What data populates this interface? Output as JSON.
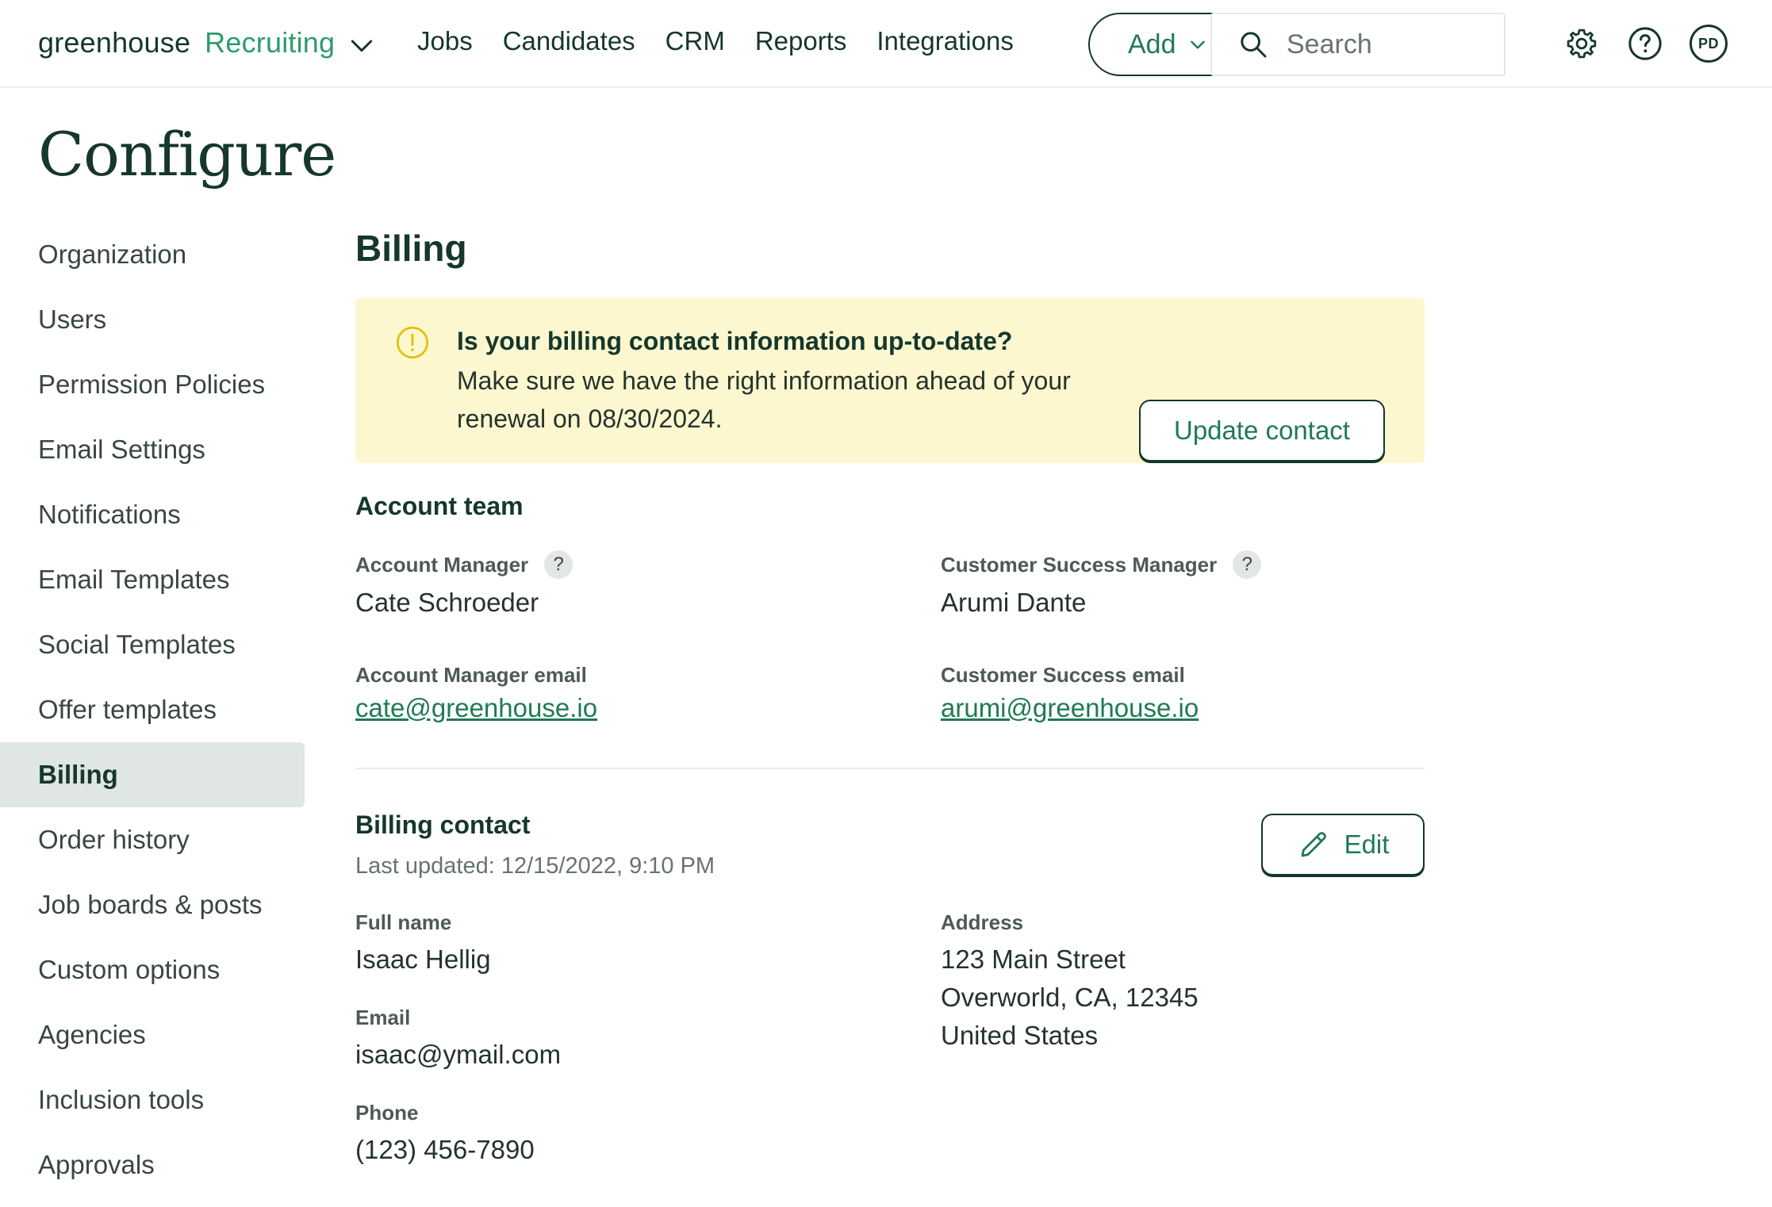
{
  "brand": {
    "name": "greenhouse",
    "product": "Recruiting"
  },
  "nav": {
    "items": [
      "Jobs",
      "Candidates",
      "CRM",
      "Reports",
      "Integrations"
    ]
  },
  "toolbar": {
    "add_label": "Add",
    "search_placeholder": "Search",
    "avatar_initials": "PD"
  },
  "page": {
    "title": "Configure"
  },
  "sidebar": {
    "items": [
      {
        "label": "Organization"
      },
      {
        "label": "Users"
      },
      {
        "label": "Permission Policies"
      },
      {
        "label": "Email Settings"
      },
      {
        "label": "Notifications"
      },
      {
        "label": "Email Templates"
      },
      {
        "label": "Social Templates"
      },
      {
        "label": "Offer templates"
      },
      {
        "label": "Billing",
        "active": true
      },
      {
        "label": "Order history"
      },
      {
        "label": "Job boards & posts"
      },
      {
        "label": "Custom options"
      },
      {
        "label": "Agencies"
      },
      {
        "label": "Inclusion tools"
      },
      {
        "label": "Approvals"
      }
    ]
  },
  "billing": {
    "title": "Billing",
    "alert": {
      "title": "Is your billing contact information up-to-date?",
      "body": "Make sure we have the right information ahead of your renewal on 08/30/2024.",
      "button": "Update contact",
      "icon": "warning-icon"
    },
    "account_team": {
      "title": "Account team",
      "account_manager_label": "Account Manager",
      "account_manager": "Cate Schroeder",
      "csm_label": "Customer Success Manager",
      "csm": "Arumi Dante",
      "am_email_label": "Account Manager email",
      "am_email": "cate@greenhouse.io",
      "cs_email_label": "Customer Success email",
      "cs_email": "arumi@greenhouse.io"
    },
    "contact": {
      "title": "Billing contact",
      "last_updated": "Last updated: 12/15/2022, 9:10 PM",
      "edit_label": "Edit",
      "full_name_label": "Full name",
      "full_name": "Isaac Hellig",
      "email_label": "Email",
      "email": "isaac@ymail.com",
      "phone_label": "Phone",
      "phone": "(123) 456-7890",
      "address_label": "Address",
      "address_line1": "123 Main Street",
      "address_line2": "Overworld, CA, 12345",
      "address_line3": "United States"
    }
  },
  "colors": {
    "brand_dark": "#15372c",
    "brand_green": "#2e9c6c",
    "link_green": "#1f7a55",
    "alert_bg": "#fdf7cf",
    "active_bg": "#dfe6e3"
  }
}
